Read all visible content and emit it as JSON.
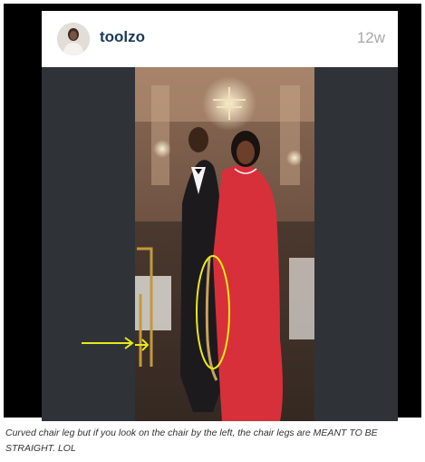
{
  "post": {
    "username": "toolzo",
    "age": "12w",
    "image_alt": "Photo of a man in a black tuxedo and a woman in a red lace gown at an event, with a yellow arrow and circle annotations"
  },
  "caption": "Curved chair leg but if you look on the chair by the left, the chair legs are MEANT TO BE STRAIGHT. LOL",
  "colors": {
    "frame": "#000000",
    "card_bg": "#363a3f",
    "username": "#1b3a57",
    "timestamp": "#a9a9a9",
    "annotation": "#e8e81a",
    "dress": "#d8303a"
  }
}
